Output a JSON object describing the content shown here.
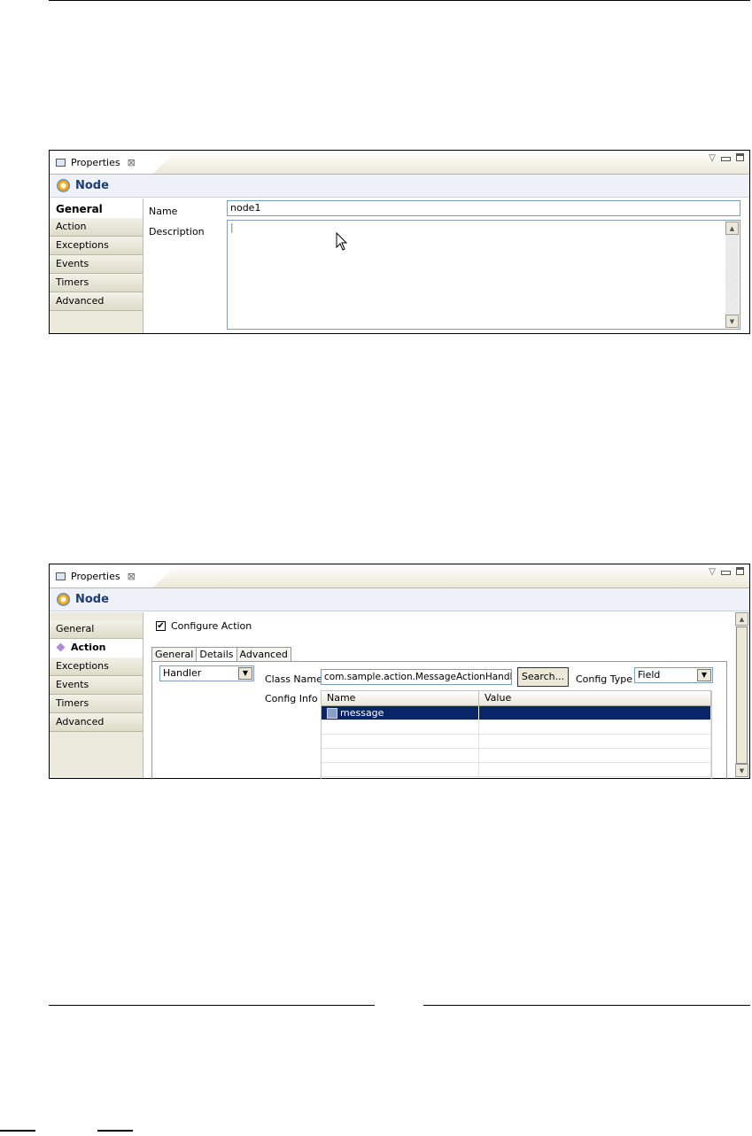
{
  "panel1": {
    "view_tab": "Properties",
    "header_title": "Node",
    "side_items": [
      "General",
      "Action",
      "Exceptions",
      "Events",
      "Timers",
      "Advanced"
    ],
    "selected": "General",
    "name_label": "Name",
    "name_value": "node1",
    "description_label": "Description",
    "description_value": "|"
  },
  "panel2": {
    "view_tab": "Properties",
    "header_title": "Node",
    "side_items": [
      "General",
      "Action",
      "Exceptions",
      "Events",
      "Timers",
      "Advanced"
    ],
    "selected": "Action",
    "configure_action_label": "Configure Action",
    "configure_action_checked": "✔",
    "inner_tabs": [
      "General",
      "Details",
      "Advanced"
    ],
    "selected_inner_tab": "Details",
    "handler_value": "Handler",
    "class_name_label": "Class Name",
    "class_name_value": "com.sample.action.MessageActionHandler",
    "search_button": "Search...",
    "config_type_label": "Config Type",
    "config_type_value": "Field",
    "config_info_label": "Config Info",
    "table_headers": [
      "Name",
      "Value"
    ],
    "table_rows": [
      [
        "message",
        ""
      ]
    ]
  }
}
